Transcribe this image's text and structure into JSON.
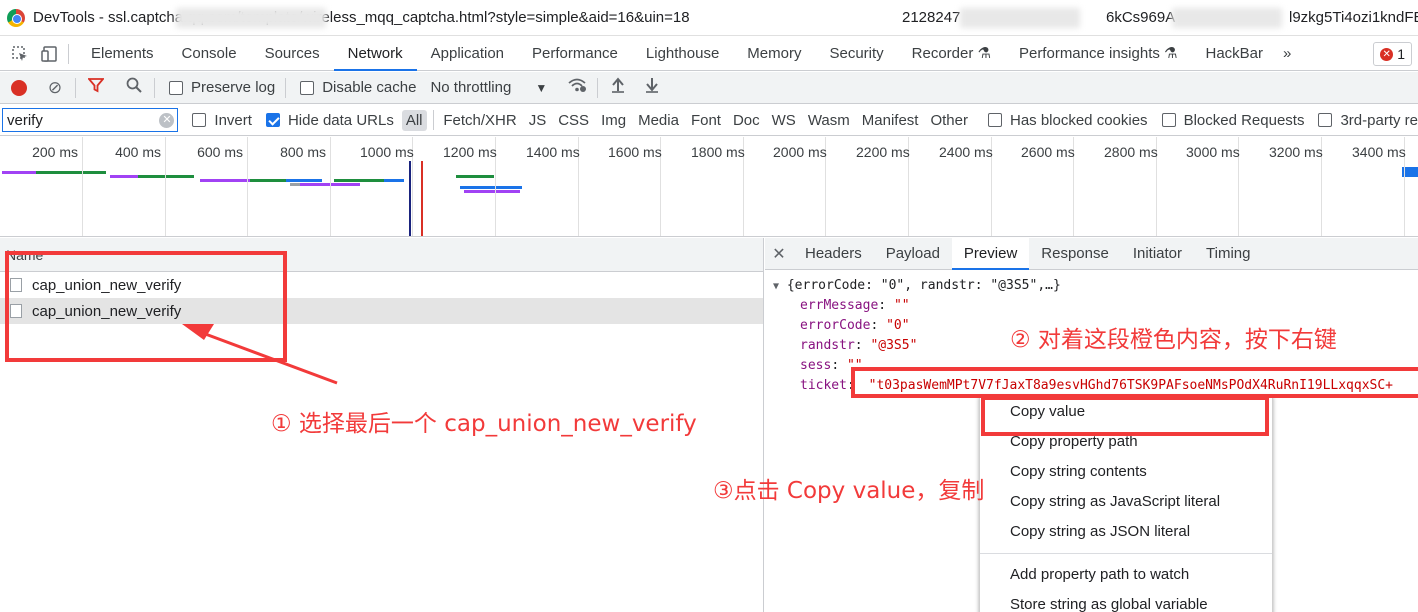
{
  "window": {
    "title": "DevTools - ssl.captcha.qq.com/template/wireless_mqq_captcha.html?style=simple&aid=16&uin=18",
    "title_frag_1": "2128247",
    "title_frag_2": "6kCs969A",
    "title_frag_3": "l9zkg5Ti4ozi1kndFB..."
  },
  "panel_tabs": [
    "Elements",
    "Console",
    "Sources",
    "Network",
    "Application",
    "Performance",
    "Lighthouse",
    "Memory",
    "Security",
    "Recorder ⚗",
    "Performance insights ⚗",
    "HackBar"
  ],
  "more_tabs": "»",
  "error_count": "1",
  "toolbar": {
    "preserve_log": "Preserve log",
    "disable_cache": "Disable cache",
    "throttling": "No throttling"
  },
  "filter": {
    "value": "verify",
    "invert": "Invert",
    "hide_data_urls": "Hide data URLs",
    "types": [
      "All",
      "Fetch/XHR",
      "JS",
      "CSS",
      "Img",
      "Media",
      "Font",
      "Doc",
      "WS",
      "Wasm",
      "Manifest",
      "Other"
    ],
    "has_blocked_cookies": "Has blocked cookies",
    "blocked_requests": "Blocked Requests",
    "third_party": "3rd-party re"
  },
  "timeline": {
    "ticks": [
      "200 ms",
      "400 ms",
      "600 ms",
      "800 ms",
      "1000 ms",
      "1200 ms",
      "1400 ms",
      "1600 ms",
      "1800 ms",
      "2000 ms",
      "2200 ms",
      "2400 ms",
      "2600 ms",
      "2800 ms",
      "3000 ms",
      "3200 ms",
      "3400 ms"
    ]
  },
  "requests": {
    "header": "Name",
    "rows": [
      "cap_union_new_verify",
      "cap_union_new_verify"
    ]
  },
  "detail_tabs": [
    "Headers",
    "Payload",
    "Preview",
    "Response",
    "Initiator",
    "Timing"
  ],
  "preview": {
    "summary": "{errorCode: \"0\", randstr: \"@3S5\",…}",
    "fields": [
      {
        "key": "errMessage",
        "value": "\"\""
      },
      {
        "key": "errorCode",
        "value": "\"0\""
      },
      {
        "key": "randstr",
        "value": "\"@3S5\""
      },
      {
        "key": "sess",
        "value": "\"\""
      },
      {
        "key": "ticket",
        "value": "\"t03pasWemMPt7V7fJaxT8a9esvHGhd76TSK9PAFsoeNMsPOdX4RuRnI19LLxqqxSC+"
      }
    ]
  },
  "context_menu": {
    "items": [
      "Copy value",
      "Copy property path",
      "Copy string contents",
      "Copy string as JavaScript literal",
      "Copy string as JSON literal"
    ],
    "items_after_sep": [
      "Add property path to watch",
      "Store string as global variable"
    ]
  },
  "annotations": {
    "step1": "① 选择最后一个 cap_union_new_verify",
    "step2": "② 对着这段橙色内容，按下右键",
    "step3": "③点击 Copy value，复制"
  },
  "colors": {
    "accent": "#1a73e8",
    "annotation_red": "#f23a3a",
    "record_red": "#d93025"
  }
}
